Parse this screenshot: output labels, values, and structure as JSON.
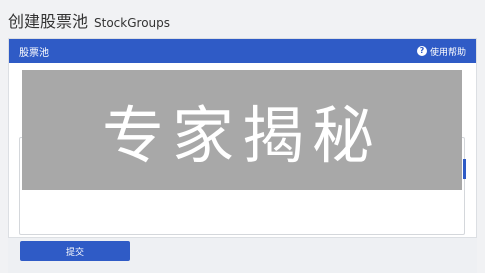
{
  "page": {
    "title": "创建股票池",
    "subtitle": "StockGroups"
  },
  "panel": {
    "title": "股票池",
    "help_label": "使用帮助"
  },
  "overlay": {
    "text": "专家揭秘"
  },
  "form": {
    "submit_label": "提交"
  },
  "colors": {
    "accent": "#2f5bc6",
    "overlay": "#a8a8a8"
  }
}
